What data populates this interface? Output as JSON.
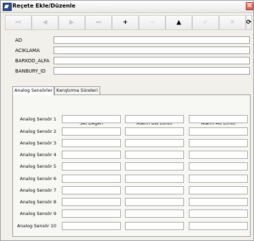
{
  "window": {
    "title": "Reçete Ekle/Düzenle",
    "close_glyph": "✕"
  },
  "toolbar": {
    "buttons": [
      {
        "icon": "first-record-icon",
        "glyph": "⏮",
        "enabled": false
      },
      {
        "icon": "prev-record-icon",
        "glyph": "◀",
        "enabled": false
      },
      {
        "icon": "next-record-icon",
        "glyph": "▶",
        "enabled": false
      },
      {
        "icon": "last-record-icon",
        "glyph": "⏭",
        "enabled": false
      },
      {
        "icon": "add-icon",
        "glyph": "+",
        "enabled": true
      },
      {
        "icon": "delete-icon",
        "glyph": "−",
        "enabled": false
      },
      {
        "icon": "edit-icon",
        "glyph": "▲",
        "enabled": true
      },
      {
        "icon": "post-icon",
        "glyph": "✓",
        "enabled": false
      },
      {
        "icon": "cancel-icon",
        "glyph": "✕",
        "enabled": false
      },
      {
        "icon": "refresh-icon",
        "glyph": "⟳",
        "enabled": true
      }
    ]
  },
  "form": {
    "fields": [
      {
        "label": "AD",
        "value": ""
      },
      {
        "label": "ACIKLAMA",
        "value": ""
      },
      {
        "label": "BARKOD_ALFA",
        "value": ""
      },
      {
        "label": "BANBURY_ID",
        "value": ""
      }
    ]
  },
  "tabs": [
    {
      "label": "Analog Sensörler",
      "active": true
    },
    {
      "label": "Karıştırma Süreleri",
      "active": false
    }
  ],
  "table": {
    "headers": [
      "Set Değeri",
      "Alarm Üst Limiti",
      "Alarm Alt Limiti"
    ],
    "rows": [
      "Analog Sensör 1",
      "Analog Sensör 2",
      "Analog Sensör 3",
      "Analog Sensör 4",
      "Analog Sensör 5",
      "Analog Sensör 6",
      "Analog Sensör 7",
      "Analog Sensör 8",
      "Analog Sensör 9",
      "Analog Sensör 10"
    ]
  }
}
